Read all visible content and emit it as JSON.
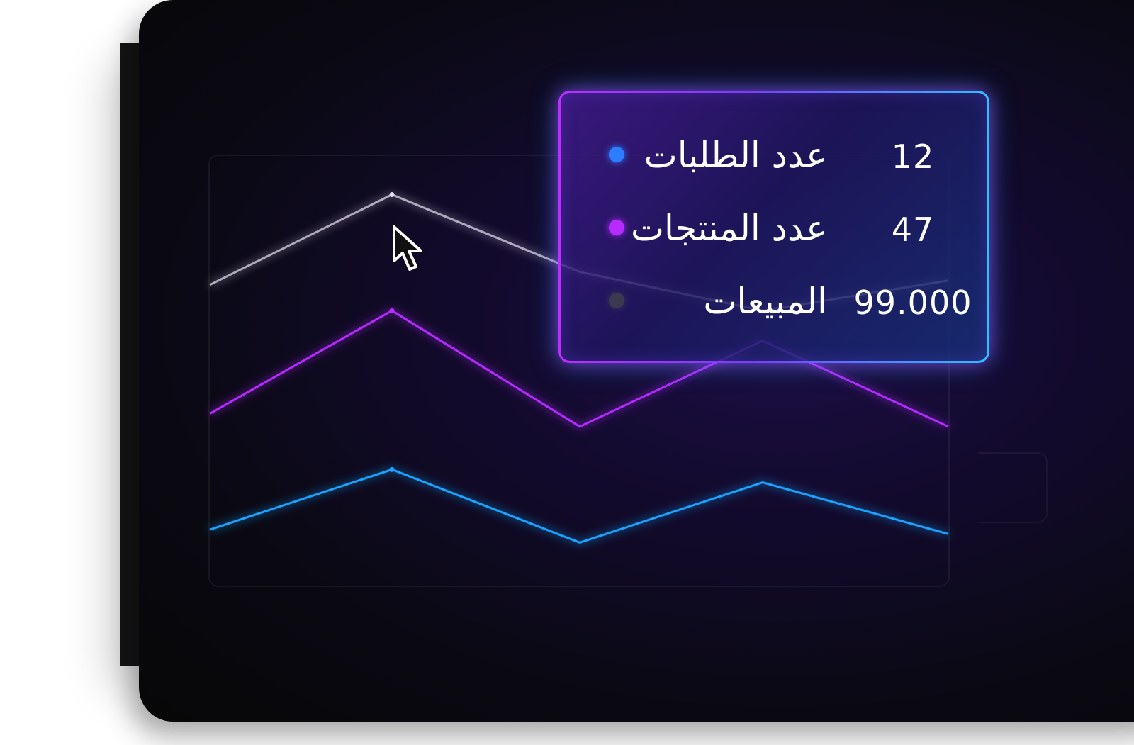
{
  "colors": {
    "background": "#070707",
    "accent_purple": "#b42cff",
    "accent_blue": "#1aa3ff",
    "accent_white": "#e6e0f0"
  },
  "chart_data": {
    "type": "line",
    "title": "",
    "xlabel": "",
    "ylabel": "",
    "x": [
      0,
      1,
      2,
      3,
      4
    ],
    "ylim": [
      0,
      100
    ],
    "grid": false,
    "series": [
      {
        "color": "#e6e0f0",
        "values": [
          70,
          91,
          73,
          64,
          71
        ]
      },
      {
        "color": "#b42cff",
        "values": [
          40,
          64,
          37,
          57,
          37
        ]
      },
      {
        "color": "#1aa3ff",
        "values": [
          13,
          27,
          10,
          24,
          12
        ]
      }
    ],
    "highlight_index": 1
  },
  "tooltip": {
    "rows": [
      {
        "label": "عدد الطلبات",
        "value": "12",
        "color": "#2f7dff"
      },
      {
        "label": "عدد المنتجات",
        "value": "47",
        "color": "#b42cff"
      },
      {
        "label": "المبيعات",
        "value": "99.000",
        "color": "#3a3950"
      }
    ]
  },
  "icons": {
    "cursor": "mouse-pointer-icon"
  }
}
